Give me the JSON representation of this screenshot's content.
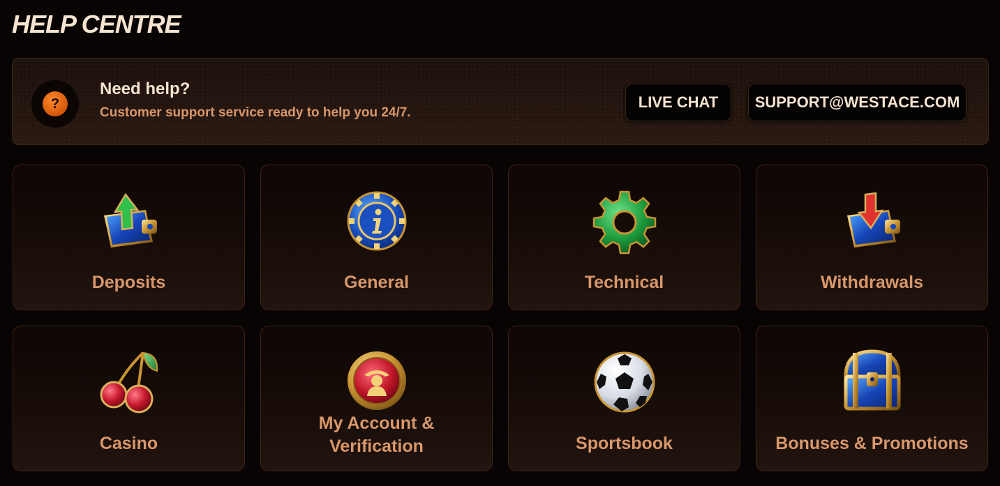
{
  "page": {
    "title": "HELP CENTRE"
  },
  "banner": {
    "icon": "question-icon",
    "badge_glyph": "?",
    "heading": "Need help?",
    "subtitle": "Customer support service ready to help you 24/7.",
    "live_chat_label": "LIVE CHAT",
    "email_label": "SUPPORT@WESTACE.COM"
  },
  "colors": {
    "background": "#080403",
    "title": "#f6e3d0",
    "accent": "#d8976a",
    "badge": "#e06a12"
  },
  "categories": [
    {
      "label": "Deposits",
      "icon": "wallet-deposit-icon"
    },
    {
      "label": "General",
      "icon": "info-chip-icon"
    },
    {
      "label": "Technical",
      "icon": "gear-icon"
    },
    {
      "label": "Withdrawals",
      "icon": "wallet-withdraw-icon"
    },
    {
      "label": "Casino",
      "icon": "cherries-icon"
    },
    {
      "label": "My Account & Verification",
      "icon": "account-coin-icon"
    },
    {
      "label": "Sportsbook",
      "icon": "soccer-ball-icon"
    },
    {
      "label": "Bonuses & Promotions",
      "icon": "treasure-chest-icon"
    }
  ]
}
